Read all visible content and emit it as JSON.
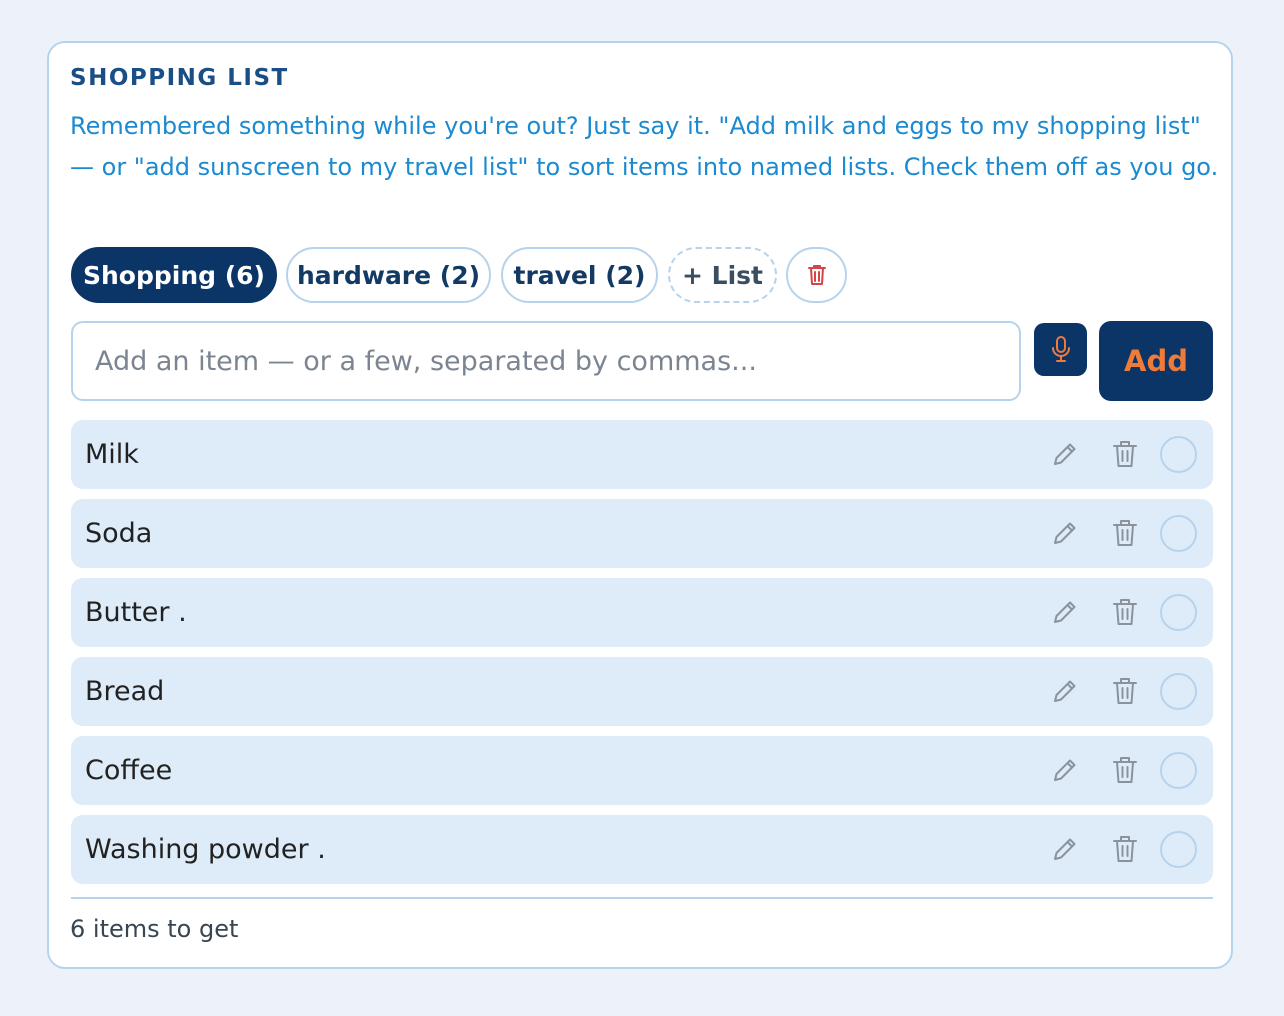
{
  "card": {
    "title": "SHOPPING LIST",
    "description": "Remembered something while you're out? Just say it. \"Add milk and eggs to my shopping list\" — or \"add sunscreen to my travel list\" to sort items into named lists. Check them off as you go."
  },
  "tabs": [
    {
      "label": "Shopping (6)",
      "active": true
    },
    {
      "label": "hardware (2)",
      "active": false
    },
    {
      "label": "travel (2)",
      "active": false
    }
  ],
  "add_list_label": "+ List",
  "delete_list_icon": "trash-icon",
  "input": {
    "placeholder": "Add an item — or a few, separated by commas...",
    "value": ""
  },
  "mic_icon": "microphone-icon",
  "add_button_label": "Add",
  "items": [
    {
      "label": "Milk",
      "checked": false
    },
    {
      "label": "Soda",
      "checked": false
    },
    {
      "label": "Butter .",
      "checked": false
    },
    {
      "label": "Bread",
      "checked": false
    },
    {
      "label": "Coffee",
      "checked": false
    },
    {
      "label": "Washing powder .",
      "checked": false
    }
  ],
  "footer": {
    "count_text": "6 items to get"
  },
  "colors": {
    "background": "#edf2fa",
    "primary": "#0a3566",
    "accent": "#f07a3a",
    "link_text": "#1b8ad1",
    "border": "#b6d3ee",
    "row_bg": "#deecf9",
    "danger": "#d64545"
  }
}
